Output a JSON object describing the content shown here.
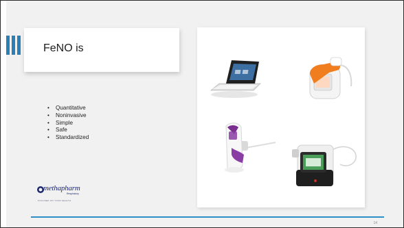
{
  "slide": {
    "title": "FeNO is",
    "bullet_marker": "•",
    "bullets": [
      "Quantitative",
      "Noninvasive",
      "Simple",
      "Safe",
      "Standardized"
    ],
    "logo": {
      "name": "methapharm",
      "subtitle": "Respiratory",
      "tagline": "FOCUSED ON YOUR HEALTH"
    },
    "page_number": "14",
    "accent_color": "#2b7fb5",
    "line_color": "#2b8fc7"
  },
  "images": {
    "devices": [
      "tablet-device-icon",
      "handheld-orange-device-icon",
      "purple-handheld-device-icon",
      "desktop-analyzer-icon"
    ]
  }
}
